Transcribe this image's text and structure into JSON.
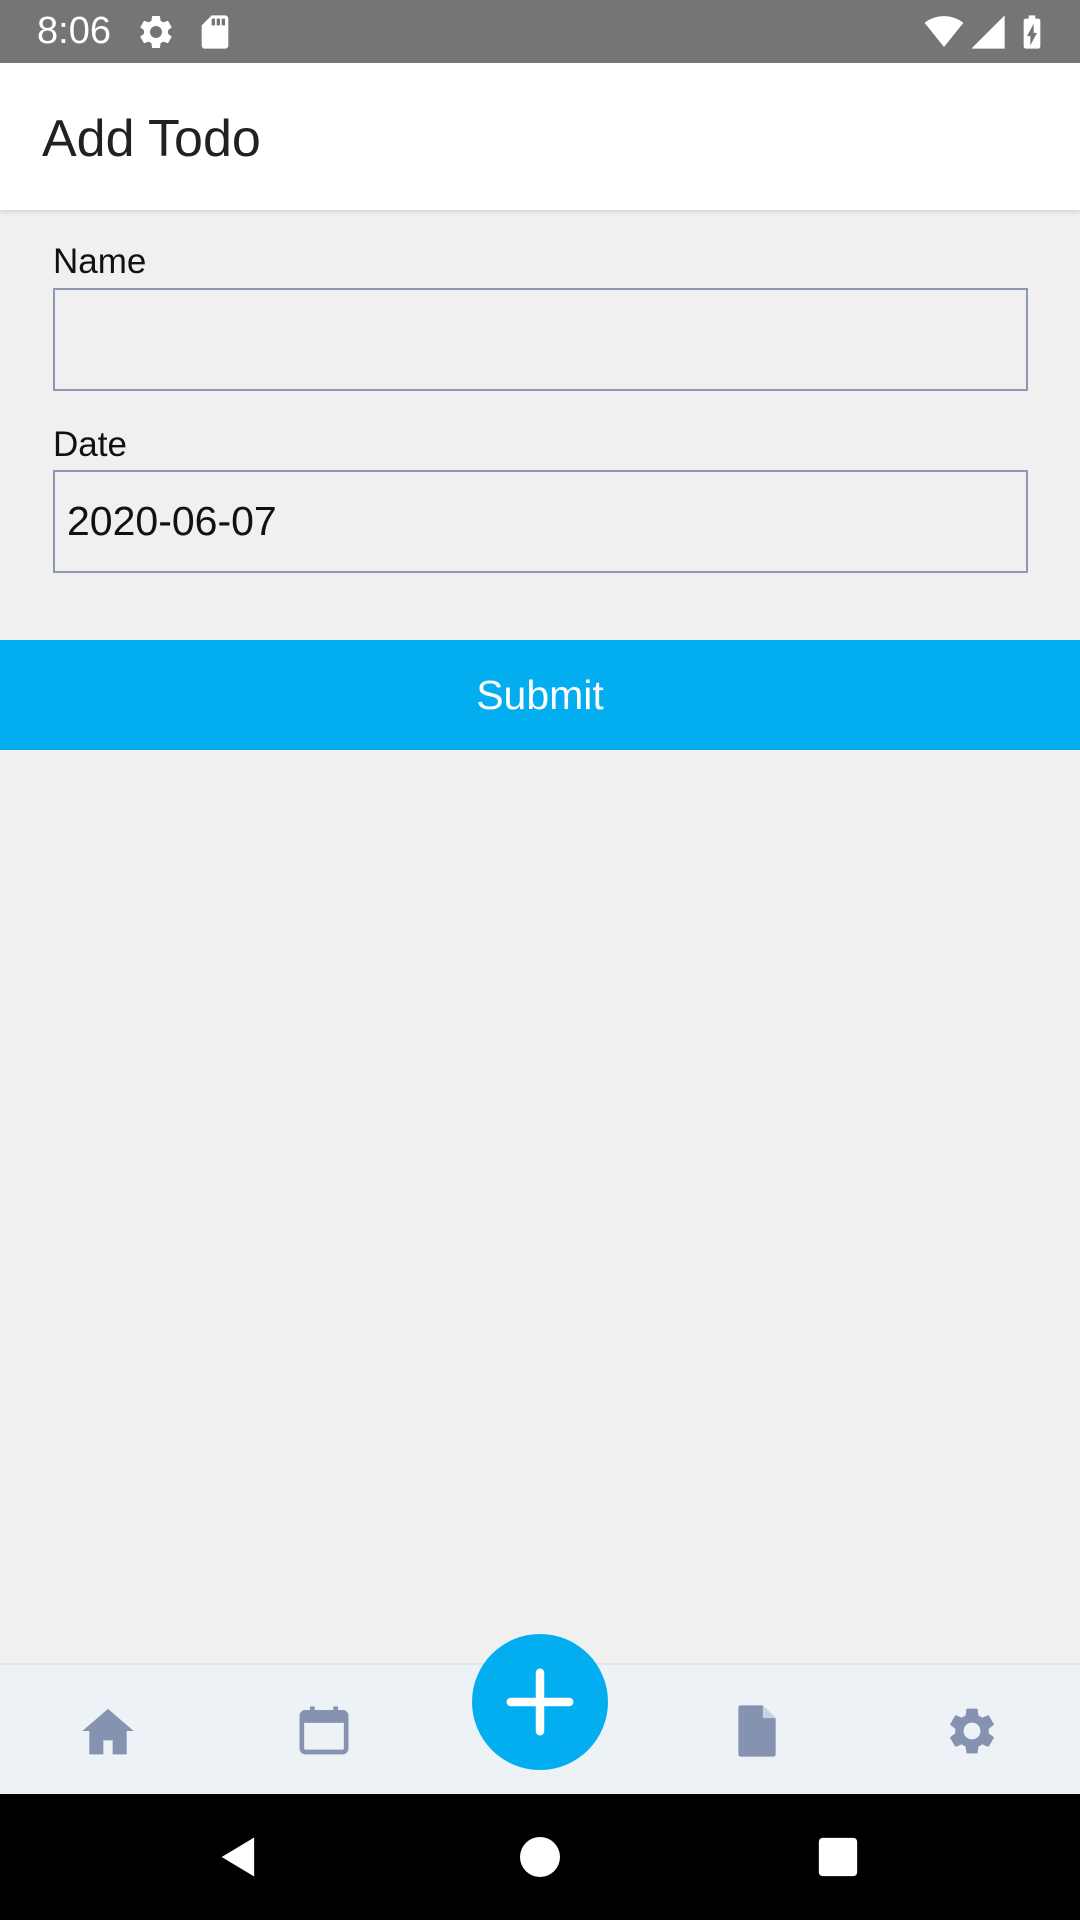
{
  "status_bar": {
    "time": "8:06",
    "icons": [
      "gear-icon",
      "sd-card-icon",
      "wifi-icon",
      "signal-icon",
      "battery-charging-icon"
    ]
  },
  "app_bar": {
    "title": "Add Todo"
  },
  "form": {
    "name_label": "Name",
    "name_value": "",
    "date_label": "Date",
    "date_value": "2020-06-07",
    "submit_label": "Submit"
  },
  "bottom_nav": {
    "items": [
      "home-icon",
      "calendar-icon",
      "add-icon",
      "document-icon",
      "settings-icon"
    ]
  },
  "system_nav": [
    "back-icon",
    "home-circle-icon",
    "recents-icon"
  ],
  "colors": {
    "accent": "#03aef0",
    "status_bar": "#757575",
    "nav_icon": "#8593b0",
    "background": "#f0f0f0"
  }
}
